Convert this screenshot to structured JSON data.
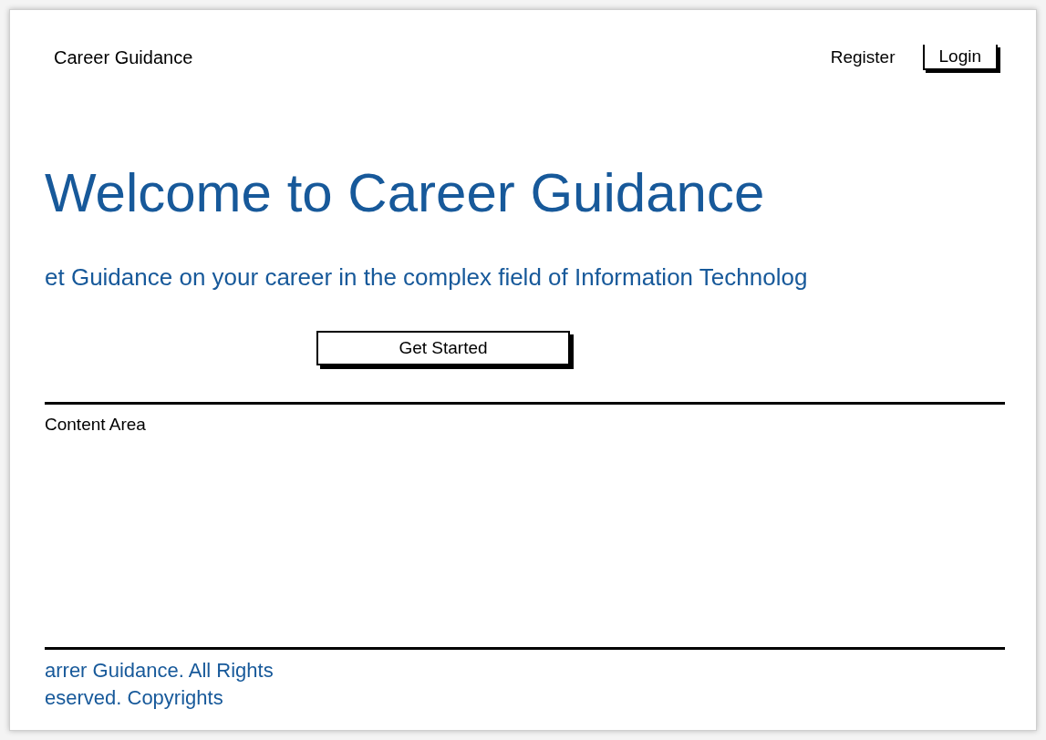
{
  "header": {
    "brand": "Career Guidance",
    "links": [
      {
        "label": "Register",
        "kind": "link"
      },
      {
        "label": "Login",
        "kind": "button"
      }
    ]
  },
  "hero": {
    "title": "Welcome to Career Guidance",
    "subtitle": "et Guidance on your career in the complex field of Information Technolog",
    "button": "Get Started"
  },
  "content": {
    "label": "Content Area"
  },
  "footer": {
    "lines": [
      "arrer Guidance. All Rights",
      "eserved. Copyrights"
    ]
  }
}
